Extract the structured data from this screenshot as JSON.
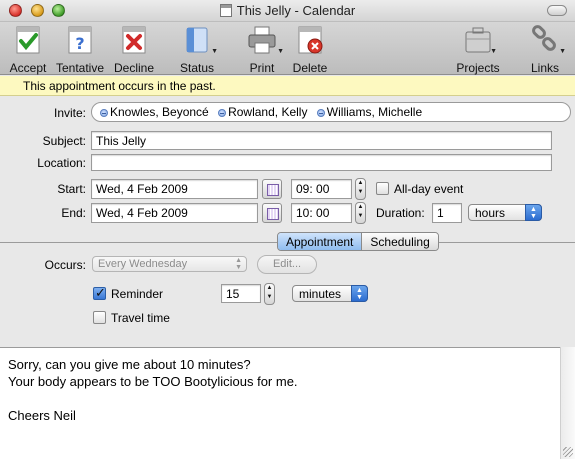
{
  "window": {
    "title": "This Jelly - Calendar"
  },
  "toolbar": {
    "accept": "Accept",
    "tentative": "Tentative",
    "decline": "Decline",
    "status": "Status",
    "print": "Print",
    "delete": "Delete",
    "projects": "Projects",
    "links": "Links"
  },
  "banner": {
    "text": "This appointment occurs in the past."
  },
  "form": {
    "invite_label": "Invite:",
    "invitees": [
      "Knowles, Beyoncé",
      "Rowland, Kelly",
      "Williams, Michelle"
    ],
    "subject_label": "Subject:",
    "subject_value": "This Jelly",
    "location_label": "Location:",
    "location_value": "",
    "start_label": "Start:",
    "start_date": "Wed, 4 Feb 2009",
    "start_time": "09: 00",
    "allday_label": "All-day event",
    "allday_checked": false,
    "end_label": "End:",
    "end_date": "Wed, 4 Feb 2009",
    "end_time": "10: 00",
    "duration_label": "Duration:",
    "duration_value": "1",
    "duration_unit": "hours"
  },
  "tabs": {
    "appointment": "Appointment",
    "scheduling": "Scheduling",
    "active": "appointment"
  },
  "details": {
    "occurs_label": "Occurs:",
    "occurs_value": "Every Wednesday",
    "edit_label": "Edit...",
    "reminder_label": "Reminder",
    "reminder_checked": true,
    "reminder_value": "15",
    "reminder_unit": "minutes",
    "travel_label": "Travel time",
    "travel_checked": false
  },
  "notes": {
    "lines": [
      "Sorry, can you give me about 10 minutes?",
      "Your body appears to be TOO Bootylicious for me.",
      "",
      "Cheers Neil"
    ]
  },
  "colors": {
    "banner_bg": "#fdf9c0",
    "accent": "#3a79d6"
  }
}
